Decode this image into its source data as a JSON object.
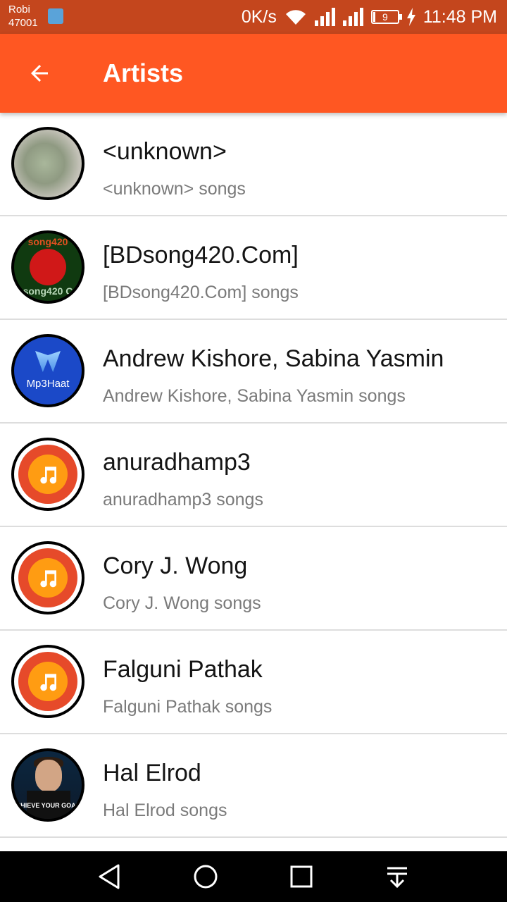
{
  "status_bar": {
    "carrier_name": "Robi",
    "carrier_code": "47001",
    "network_speed": "0K/s",
    "battery_level": "9",
    "time": "11:48 PM",
    "icons": [
      "usb-icon",
      "wifi-icon",
      "signal-icon",
      "signal-icon",
      "battery-icon",
      "charging-icon"
    ]
  },
  "app_bar": {
    "title": "Artists",
    "back_icon": "arrow-left-icon"
  },
  "artists": [
    {
      "name": "<unknown>",
      "subtitle": "<unknown> songs",
      "art": "photo"
    },
    {
      "name": "[BDsong420.Com]",
      "subtitle": "[BDsong420.Com] songs",
      "art": "bdsong-logo"
    },
    {
      "name": "Andrew Kishore, Sabina Yasmin",
      "subtitle": "Andrew Kishore, Sabina Yasmin songs",
      "art": "mp3haat-logo"
    },
    {
      "name": "anuradhamp3",
      "subtitle": "anuradhamp3 songs",
      "art": "music-note-icon"
    },
    {
      "name": "Cory J. Wong",
      "subtitle": "Cory J. Wong songs",
      "art": "music-note-icon"
    },
    {
      "name": "Falguni Pathak",
      "subtitle": "Falguni Pathak songs",
      "art": "music-note-icon"
    },
    {
      "name": "Hal Elrod",
      "subtitle": "Hal Elrod songs",
      "art": "photo"
    }
  ],
  "art_text": {
    "bdsong_top": "song420",
    "bdsong_bottom": "song420 C",
    "mp3haat": "Mp3Haat",
    "hal_elrod": "CHIEVE YOUR GOAL"
  },
  "nav_bar": {
    "buttons": [
      "back-triangle-icon",
      "home-circle-icon",
      "recents-square-icon",
      "notification-pull-icon"
    ]
  },
  "colors": {
    "app_bar": "#ff5722",
    "status_bar": "#c4461d",
    "note_ring": "#e64a2a",
    "note_core": "#ff9c12"
  }
}
